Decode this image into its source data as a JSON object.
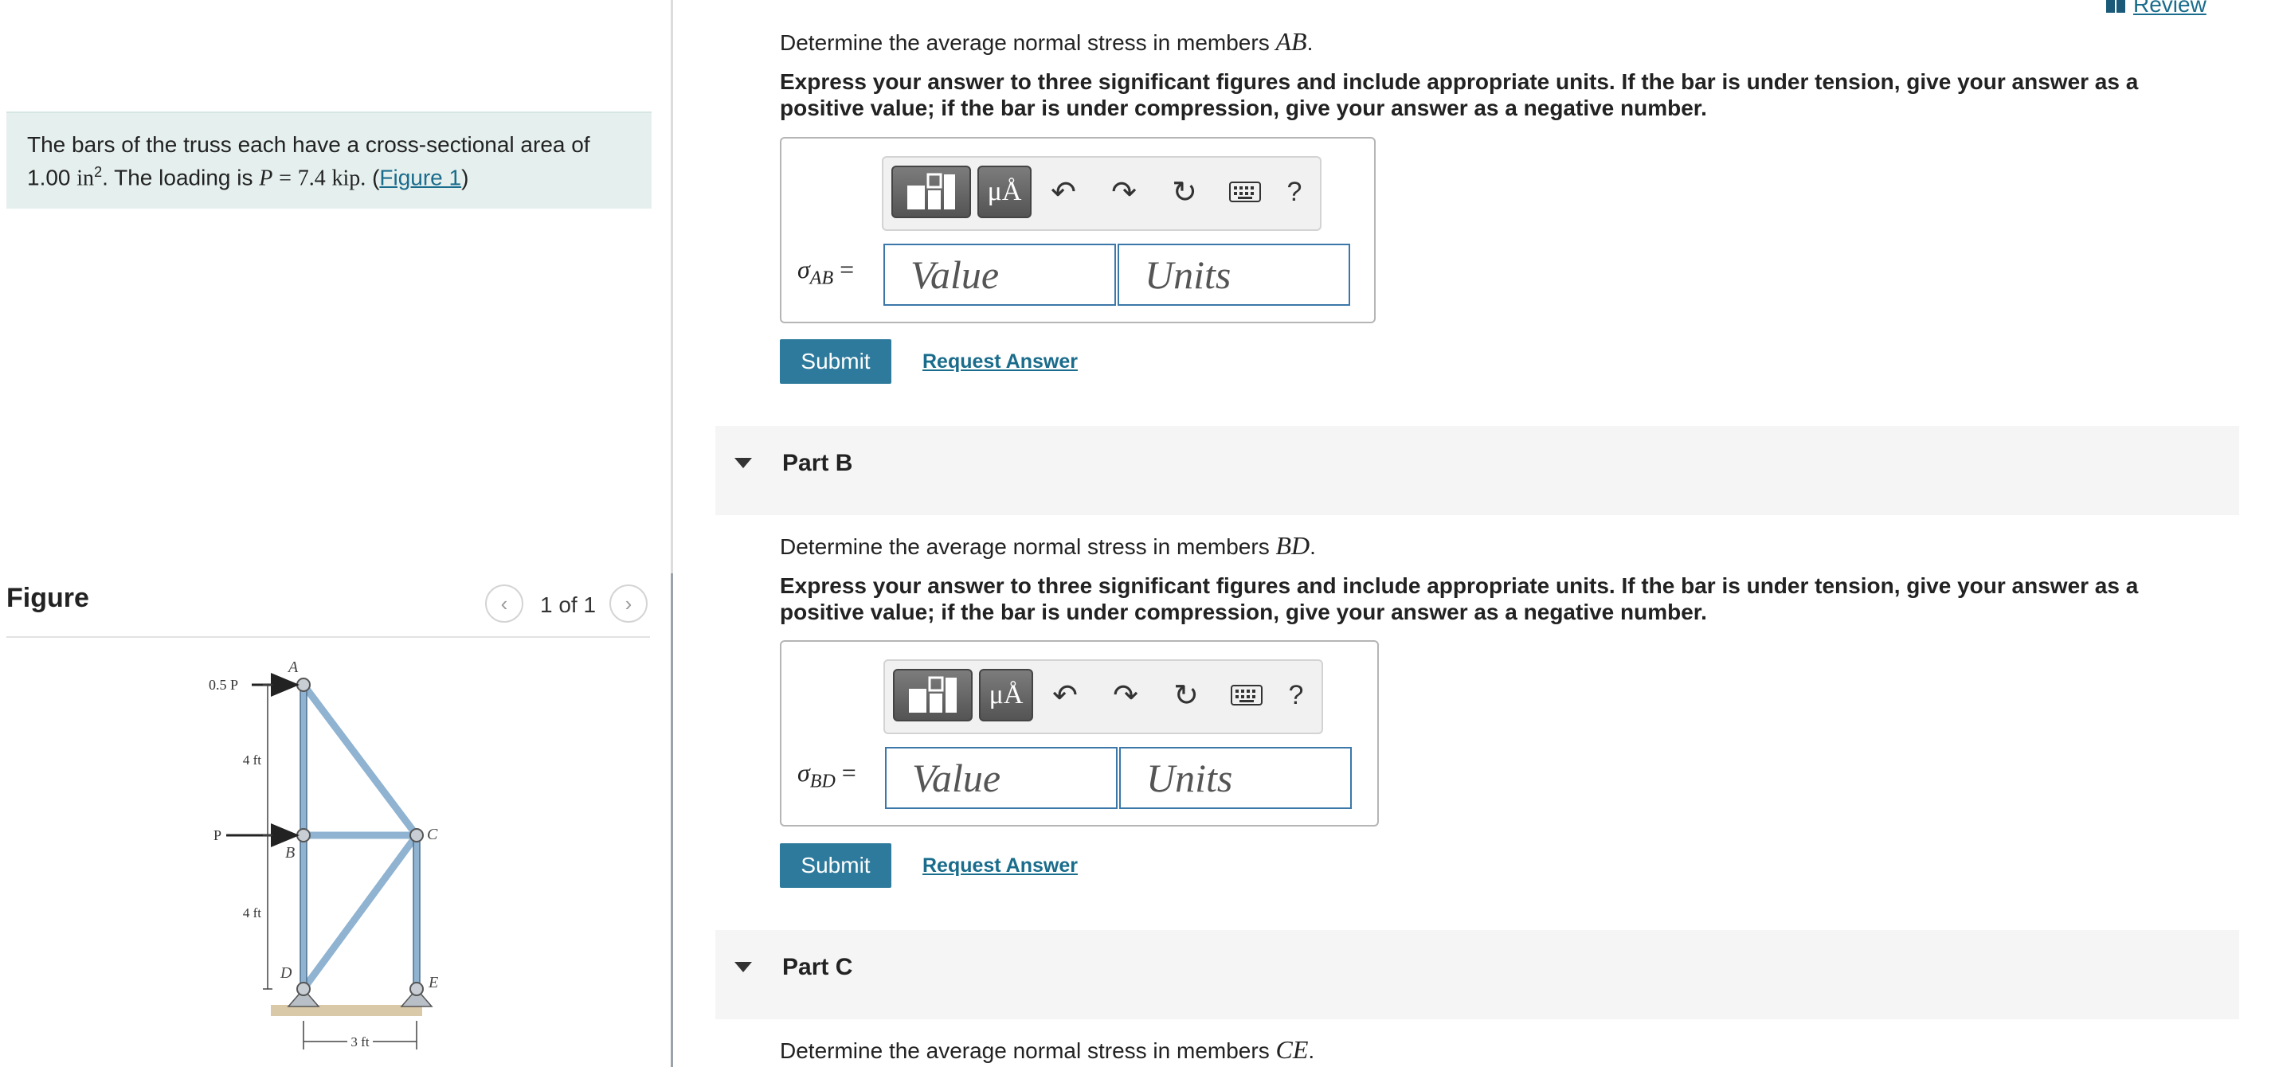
{
  "header": {
    "review_label": "Review",
    "review_icon": "book-icon"
  },
  "problem": {
    "text_part1": "The bars of the truss each have a cross-sectional area of",
    "area_value": "1.00",
    "area_unit": "in",
    "area_exponent": "2",
    "text_part2": ". The loading is",
    "load_symbol": "P",
    "load_equals": "=",
    "load_value": "7.4",
    "load_unit": "kip.",
    "figure_link": "Figure 1",
    "open_paren": "(",
    "close_paren": ")"
  },
  "figure": {
    "title": "Figure",
    "pager": "1 of 1",
    "labels": {
      "top_load": "0.5 P",
      "mid_load": "P",
      "node_a": "A",
      "node_b": "B",
      "node_c": "C",
      "node_d": "D",
      "node_e": "E",
      "dim_upper": "4 ft",
      "dim_lower": "4 ft",
      "dim_width": "3 ft"
    }
  },
  "toolbar": {
    "units_symbol": "μÅ",
    "help_symbol": "?"
  },
  "parts": [
    {
      "prompt_text": "Determine the average normal stress in members",
      "member": "AB",
      "instruction": "Express your answer to three significant figures and include appropriate units. If the bar is under tension, give your answer as a positive value; if the bar is under compression, give your answer as a negative number.",
      "sigma": "σ",
      "sigma_sub": "AB",
      "equals": "=",
      "value_placeholder": "Value",
      "units_placeholder": "Units",
      "submit": "Submit",
      "request": "Request Answer"
    },
    {
      "title": "Part B",
      "prompt_text": "Determine the average normal stress in members",
      "member": "BD",
      "instruction": "Express your answer to three significant figures and include appropriate units. If the bar is under tension, give your answer as a positive value; if the bar is under compression, give your answer as a negative number.",
      "sigma": "σ",
      "sigma_sub": "BD",
      "equals": "=",
      "value_placeholder": "Value",
      "units_placeholder": "Units",
      "submit": "Submit",
      "request": "Request Answer"
    },
    {
      "title": "Part C",
      "prompt_text": "Determine the average normal stress in members",
      "member": "CE"
    }
  ],
  "colors": {
    "accent": "#2e7a9c",
    "link": "#1a6c8c",
    "problem_bg": "#e5f0ee",
    "input_border": "#3b77a8"
  }
}
